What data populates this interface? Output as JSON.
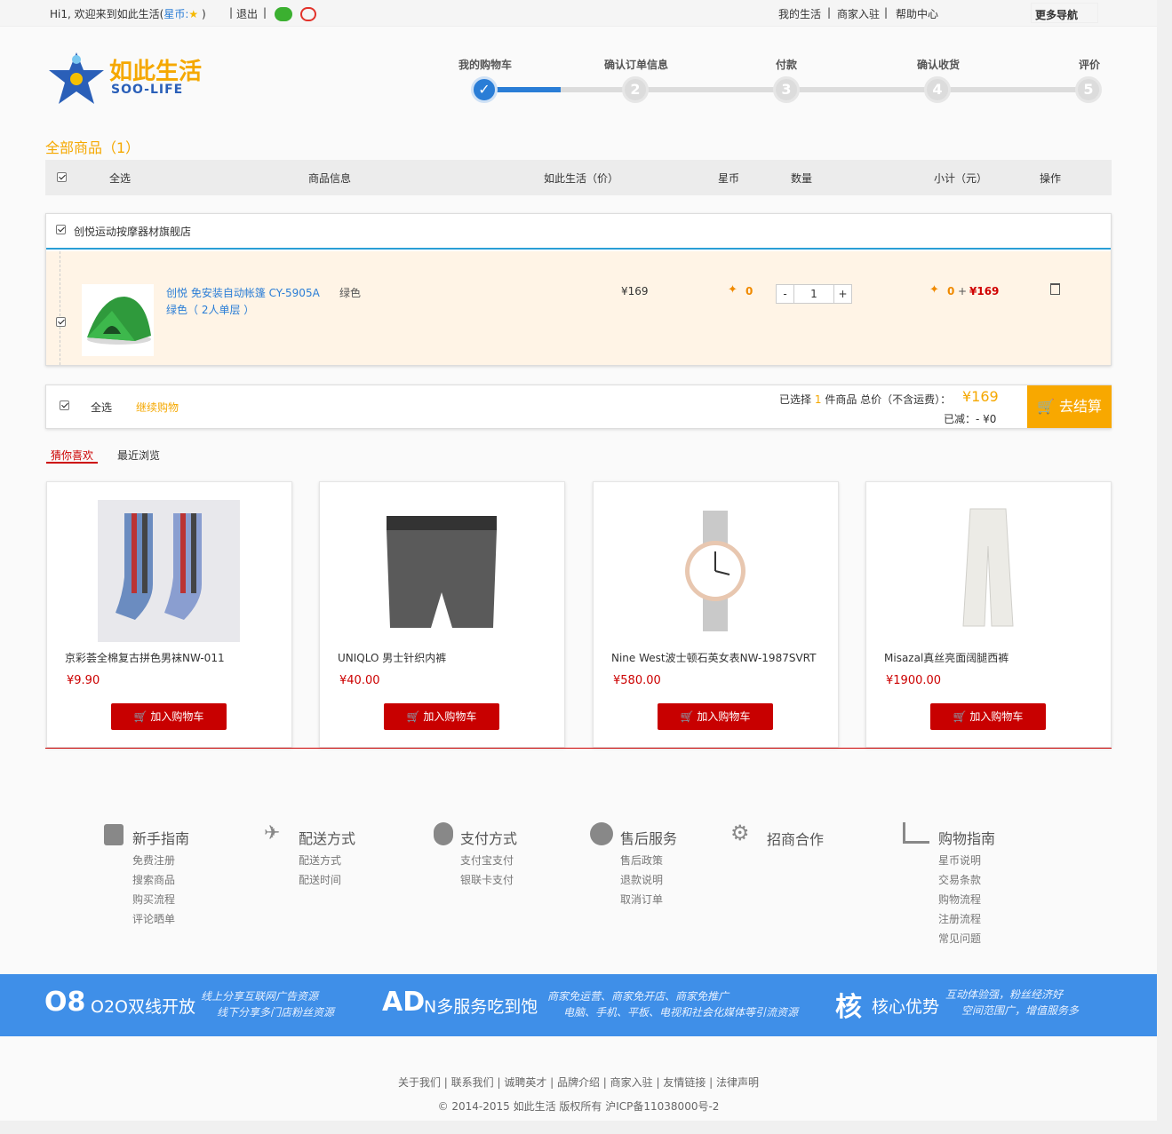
{
  "topbar": {
    "greeting": "Hi1, 欢迎来到如此生活(",
    "xingbi_label": "星币:",
    "greeting_end": ")",
    "logout": "退出",
    "links": [
      "我的生活",
      "商家入驻",
      "帮助中心"
    ],
    "more_nav": "更多导航"
  },
  "logo": {
    "cn": "如此生活",
    "en": "SOO-LIFE"
  },
  "progress": {
    "steps": [
      {
        "label": "我的购物车",
        "num": "✓"
      },
      {
        "label": "确认订单信息",
        "num": "2"
      },
      {
        "label": "付款",
        "num": "3"
      },
      {
        "label": "确认收货",
        "num": "4"
      },
      {
        "label": "评价",
        "num": "5"
      }
    ],
    "current_fraction": 0.1
  },
  "cart": {
    "title": "全部商品（1）",
    "headers": {
      "select_all": "全选",
      "info": "商品信息",
      "price": "如此生活（价）",
      "coin": "星币",
      "qty": "数量",
      "subtotal": "小计（元）",
      "action": "操作"
    },
    "store_name": "创悦运动按摩器材旗舰店",
    "item": {
      "name_line1": "创悦 免安装自动帐篷 CY-5905A",
      "name_line2": "绿色（ 2人单层 ）",
      "spec": "绿色",
      "price": "¥169",
      "coin": "0",
      "qty": "1",
      "minus": "-",
      "plus": "+",
      "sub_coin": "0",
      "sub_plus": "+",
      "sub_price": "¥169"
    },
    "summary": {
      "select_all": "全选",
      "continue": "继续购物",
      "selected_pre": "已选择",
      "selected_count": "1",
      "selected_post": "件商品  总价（不含运费）：",
      "total": "¥169",
      "discount": "已减：- ¥0",
      "checkout": "去结算"
    }
  },
  "tabs": [
    "猜你喜欢",
    "最近浏览"
  ],
  "products": [
    {
      "name": "京彩荟全棉复古拼色男袜NW-011",
      "price": "¥9.90",
      "btn": "加入购物车"
    },
    {
      "name": "UNIQLO 男士针织内裤",
      "price": "¥40.00",
      "btn": "加入购物车"
    },
    {
      "name": "Nine West波士顿石英女表NW-1987SVRT",
      "price": "¥580.00",
      "btn": "加入购物车"
    },
    {
      "name": "Misazal真丝亮面阔腿西裤",
      "price": "¥1900.00",
      "btn": "加入购物车"
    }
  ],
  "help": [
    {
      "title": "新手指南",
      "links": [
        "免费注册",
        "搜索商品",
        "购买流程",
        "评论晒单"
      ]
    },
    {
      "title": "配送方式",
      "links": [
        "配送方式",
        "配送时间"
      ]
    },
    {
      "title": "支付方式",
      "links": [
        "支付宝支付",
        "银联卡支付"
      ]
    },
    {
      "title": "售后服务",
      "links": [
        "售后政策",
        "退款说明",
        "取消订单"
      ]
    },
    {
      "title": "招商合作",
      "links": []
    },
    {
      "title": "购物指南",
      "links": [
        "星币说明",
        "交易条款",
        "购物流程",
        "注册流程",
        "常见问题"
      ]
    }
  ],
  "banner": [
    {
      "icon": "O8",
      "big": "O2O双线开放",
      "small1": "线上分享互联网广告资源",
      "small2": "线下分享多门店粉丝资源"
    },
    {
      "icon": "AD",
      "big": "N多服务吃到饱",
      "small1": "商家免运营、商家免开店、商家免推广",
      "small2": "电脑、手机、平板、电视和社会化媒体等引流资源"
    },
    {
      "icon": "核",
      "big": "核心优势",
      "small1": "互动体验强，粉丝经济好",
      "small2": "空间范围广，增值服务多"
    }
  ],
  "footer": {
    "links": "关于我们  |  联系我们  |  诚聘英才  |  品牌介绍  |  商家入驻  |  友情链接  |  法律声明",
    "copyright": "© 2014-2015 如此生活 版权所有 沪ICP备11038000号-2"
  },
  "colors": {
    "accent": "#2a7dd6",
    "orange": "#f8a800",
    "red": "#c80000",
    "bluebar": "#3f8fe8"
  }
}
